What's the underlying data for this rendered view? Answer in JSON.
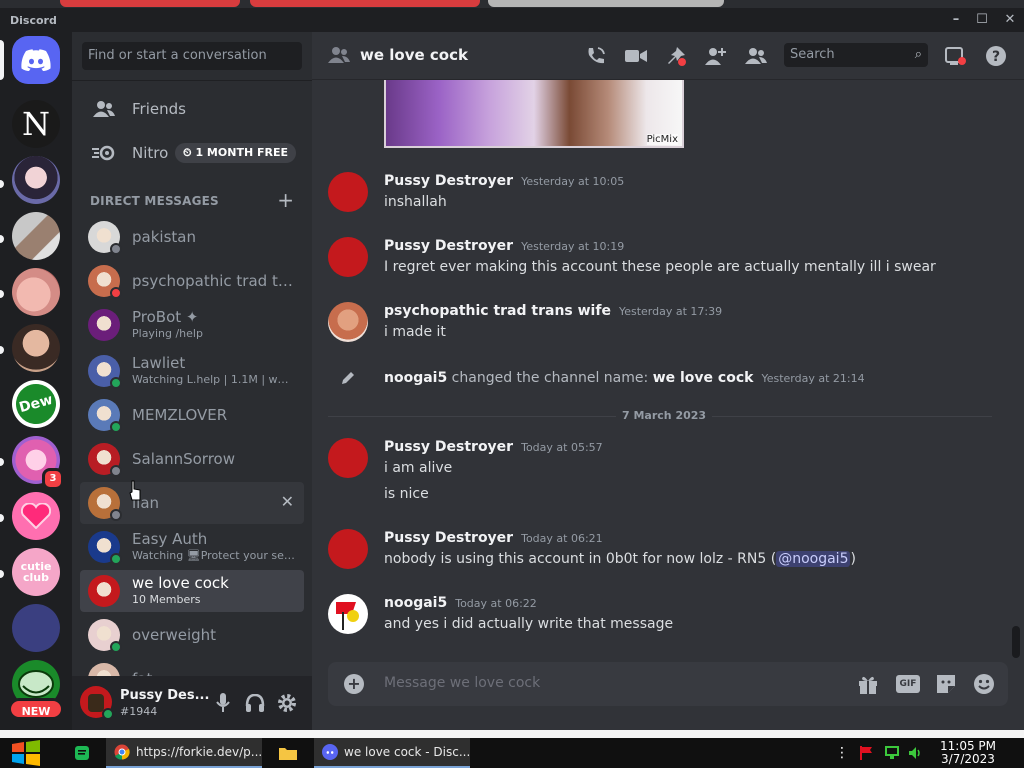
{
  "window": {
    "app_name": "Discord",
    "minimize": "–",
    "maximize": "☐",
    "close": "✕"
  },
  "servers": [
    {
      "name": "server-n",
      "glyph": "N"
    },
    {
      "name": "server-anime-avatar"
    },
    {
      "name": "server-room"
    },
    {
      "name": "server-peach"
    },
    {
      "name": "server-person"
    },
    {
      "name": "server-mtn-dew"
    },
    {
      "name": "server-pink-anime",
      "badge": "3"
    },
    {
      "name": "server-pink-heart"
    },
    {
      "name": "server-cutie-club",
      "glyph": "cutie club"
    },
    {
      "name": "server-blue-logo"
    },
    {
      "name": "server-trollface"
    }
  ],
  "new_badge": "NEW",
  "sidebar": {
    "search_placeholder": "Find or start a conversation",
    "friends_label": "Friends",
    "nitro_label": "Nitro",
    "nitro_badge": "1 MONTH FREE",
    "dm_header": "DIRECT MESSAGES",
    "dm_add": "+",
    "dms": [
      {
        "name": "pakistan",
        "status": "off",
        "color": "#d8d8d8"
      },
      {
        "name": "psychopathic trad tra...",
        "status": "dnd",
        "color": "#c76d4d"
      },
      {
        "name": "ProBot ✦",
        "sub": "Playing /help",
        "status": "none",
        "color": "#6b1e7a"
      },
      {
        "name": "Lawliet",
        "sub": "Watching L.help | 1.1M | www.l...",
        "status": "on",
        "color": "#4a5fa8"
      },
      {
        "name": "MEMZLOVER",
        "status": "on",
        "color": "#5a7ab8"
      },
      {
        "name": "SalannSorrow",
        "status": "off",
        "color": "#b81d24"
      },
      {
        "name": "lian",
        "status": "off",
        "color": "#b8703a",
        "hover": true
      },
      {
        "name": "Easy Auth",
        "sub": "Watching 🖥Protect your serv...",
        "status": "on",
        "color": "#1a3a8c"
      },
      {
        "name": "we love cock",
        "sub": "10 Members",
        "status": "none",
        "color": "#c4191d",
        "selected": true
      },
      {
        "name": "overweight",
        "status": "on",
        "color": "#e8d0d0"
      },
      {
        "name": "fat",
        "status": "off",
        "color": "#d8b8a8"
      }
    ]
  },
  "user_panel": {
    "name": "Pussy Des...",
    "tag": "#1944"
  },
  "chat": {
    "channel_name": "we love cock",
    "search_placeholder": "Search",
    "attachment_watermark": "PicMix",
    "messages": [
      {
        "author": "Pussy Destroyer",
        "time": "Yesterday at 10:05",
        "lines": [
          "inshallah"
        ]
      },
      {
        "author": "Pussy Destroyer",
        "time": "Yesterday at 10:19",
        "lines": [
          "I regret ever making this account these people are actually mentally ill i swear"
        ]
      },
      {
        "author": "psychopathic trad trans wife",
        "time": "Yesterday at 17:39",
        "lines": [
          "i made it"
        ]
      },
      {
        "author": "Pussy Destroyer",
        "time": "Today at 05:57",
        "lines": [
          "i am alive",
          "is nice"
        ]
      },
      {
        "author": "Pussy Destroyer",
        "time": "Today at 06:21",
        "text_before": "nobody is using this account in 0b0t for now lolz - RN5 (",
        "mention": "@noogai5",
        "text_after": ")"
      },
      {
        "author": "noogai5",
        "time": "Today at 06:22",
        "lines": [
          "and yes i did actually write that message"
        ]
      }
    ],
    "system": {
      "actor": "noogai5",
      "action": " changed the channel name: ",
      "new_name": "we love cock",
      "time": "Yesterday at 21:14"
    },
    "date_divider": "7 March 2023",
    "composer_placeholder": "Message we love cock",
    "gif_label": "GIF"
  },
  "taskbar": {
    "chrome_title": "https://forkie.dev/p...",
    "discord_title": "we love cock - Disc...",
    "time": "11:05 PM",
    "date": "3/7/2023"
  }
}
